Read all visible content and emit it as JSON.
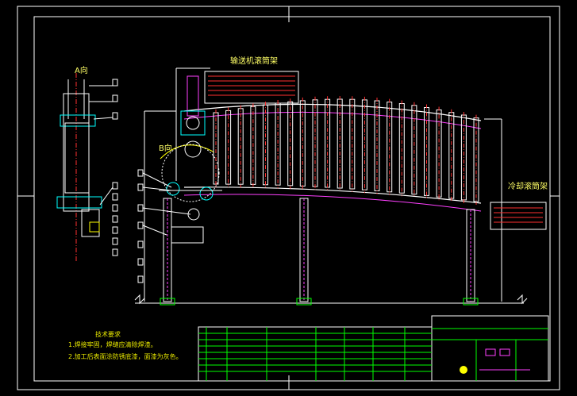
{
  "drawing": {
    "label_upper_conveyor": "输送机滚筒架",
    "label_lower_conveyor": "冷却滚筒架",
    "view_label_a": "A向",
    "view_label_b": "B向",
    "notes_title": "技术要求",
    "notes": [
      "1.焊接牢固，焊缝应清除焊渣。",
      "2.加工后表面涂防锈底漆，面漆为灰色。"
    ]
  },
  "colors": {
    "background": "#000000",
    "line_white": "#ffffff",
    "line_yellow": "#ffff00",
    "line_green": "#00ff00",
    "line_magenta": "#ff40ff",
    "line_red": "#ff3030",
    "line_cyan": "#00ffff"
  }
}
